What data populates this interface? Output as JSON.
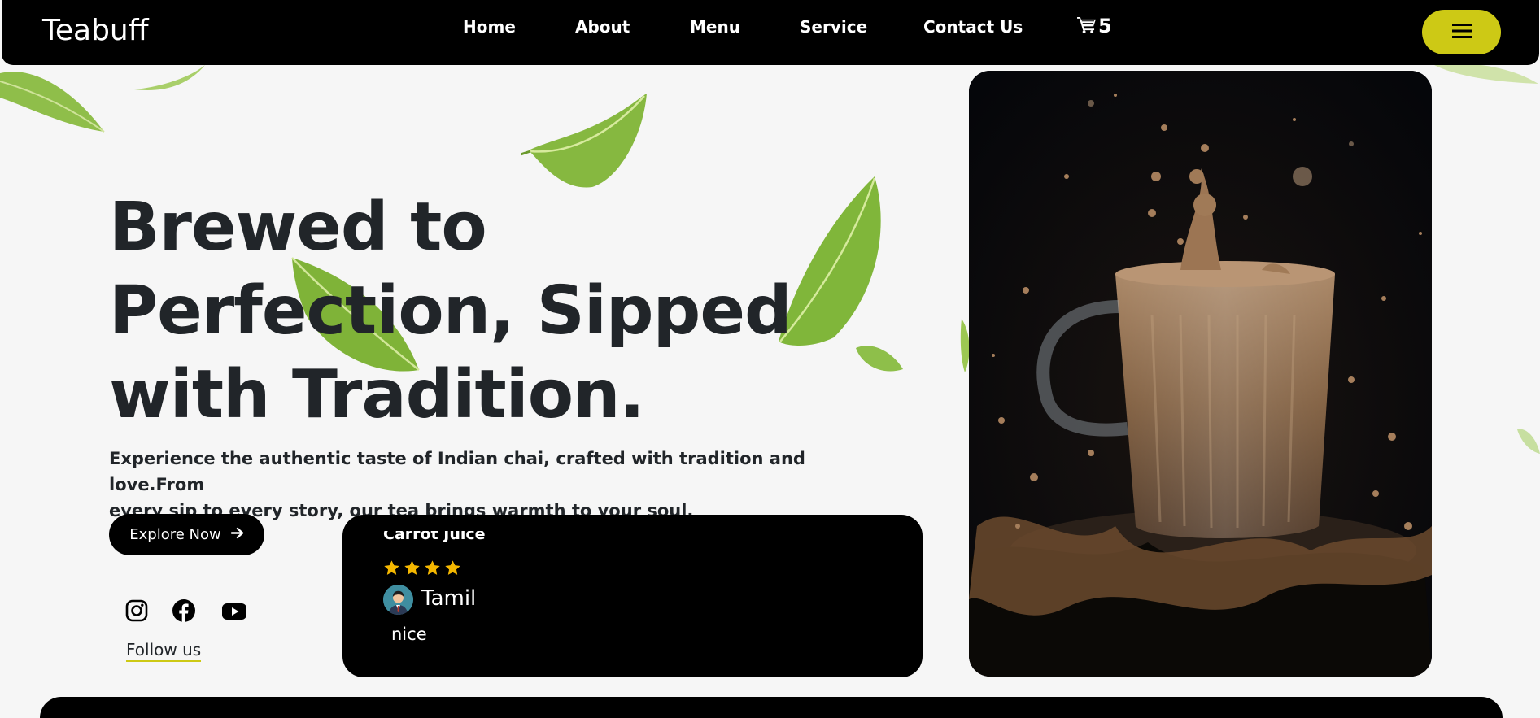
{
  "navbar": {
    "brand": "Teabuff",
    "links": [
      {
        "label": "Home"
      },
      {
        "label": "About"
      },
      {
        "label": "Menu"
      },
      {
        "label": "Service"
      },
      {
        "label": "Contact Us"
      }
    ],
    "cart_count": "5",
    "cart_icon": "cart-icon",
    "menu_icon": "hamburger-icon"
  },
  "hero": {
    "title_line1": "Brewed to",
    "title_line2": "Perfection, Sipped",
    "title_line3": "with Tradition.",
    "subtitle_line1": "Experience the authentic taste of Indian chai, crafted with tradition and love.From",
    "subtitle_line2": "every sip to every story, our tea brings warmth to your soul.",
    "cta_label": "Explore Now",
    "cta_icon": "arrow-right-icon",
    "follow_label": "Follow us",
    "social": [
      "instagram-icon",
      "facebook-icon",
      "youtube-icon"
    ]
  },
  "review": {
    "product": "Carrot Juice",
    "rating": 4,
    "rating_max": 4,
    "reviewer": "Tamil",
    "text": "nice"
  },
  "colors": {
    "accent": "#cdc915",
    "background": "#f6f6f6",
    "dark": "#000000",
    "heading": "#212529",
    "star": "#f5b800"
  }
}
